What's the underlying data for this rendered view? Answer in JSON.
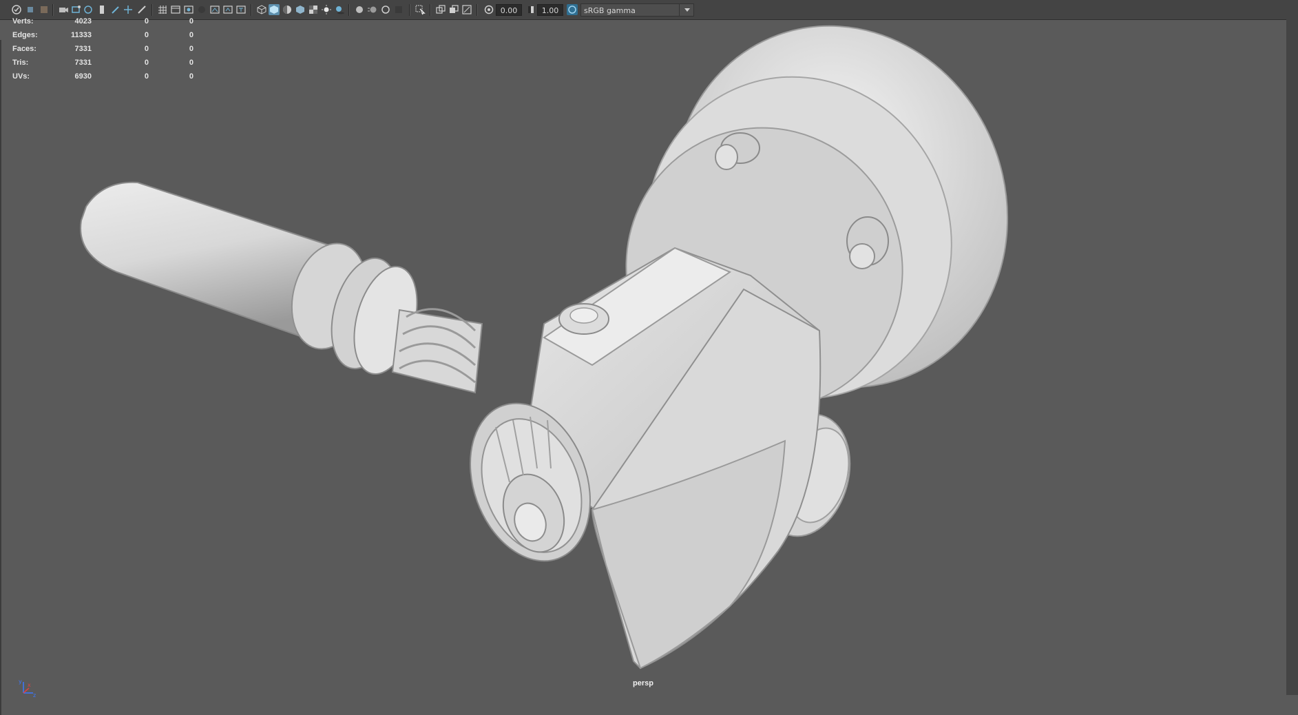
{
  "toolbar": {
    "exposure_value": "0.00",
    "gamma_value": "1.00",
    "color_space": "sRGB gamma",
    "icons": [
      "select-camera-icon",
      "camera-attributes-icon",
      "bookmark-icon",
      "image-plane-icon",
      "2d-pan-zoom-icon",
      "grease-pencil-icon",
      "grid-icon",
      "film-gate-icon",
      "resolution-gate-icon",
      "gate-mask-icon",
      "field-chart-icon",
      "safe-action-icon",
      "safe-title-icon",
      "wireframe-icon",
      "smooth-shade-icon",
      "wireframe-on-shaded-icon",
      "default-material-icon",
      "textured-icon",
      "use-all-lights-icon",
      "shadows-icon",
      "screen-space-ao-icon",
      "motion-blur-icon",
      "multisample-aa-icon",
      "depth-of-field-icon",
      "isolate-select-icon",
      "xray-icon",
      "xray-joints-icon",
      "xray-components-icon",
      "exposure-icon",
      "gamma-icon",
      "color-management-icon",
      "dropdown-arrow-icon"
    ]
  },
  "hud": {
    "rows": [
      {
        "label": "Verts:",
        "values": [
          "4023",
          "0",
          "0"
        ]
      },
      {
        "label": "Edges:",
        "values": [
          "11333",
          "0",
          "0"
        ]
      },
      {
        "label": "Faces:",
        "values": [
          "7331",
          "0",
          "0"
        ]
      },
      {
        "label": "Tris:",
        "values": [
          "7331",
          "0",
          "0"
        ]
      },
      {
        "label": "UVs:",
        "values": [
          "6930",
          "0",
          "0"
        ]
      }
    ]
  },
  "viewport": {
    "camera": "persp",
    "background_color": "#5a5a5a",
    "model_color": "#d6d6d6"
  },
  "axis": {
    "x": "x",
    "y": "y",
    "z": "z"
  }
}
